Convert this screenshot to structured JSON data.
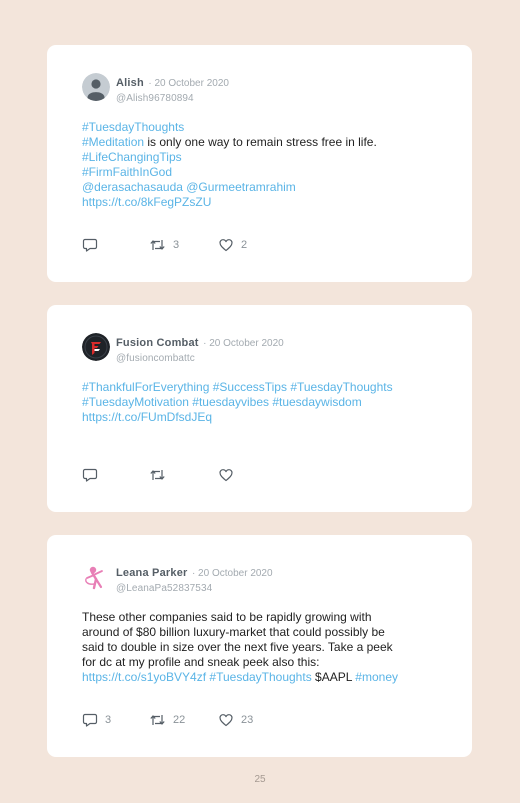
{
  "tweets": [
    {
      "name": "Alish",
      "date": "· 20 October 2020",
      "handle": "@Alish96780894",
      "lines": [
        [
          {
            "t": "#TuesdayThoughts",
            "link": true
          }
        ],
        [
          {
            "t": "#Meditation",
            "link": true
          },
          {
            "t": " is only one way to remain stress free in life.",
            "link": false
          }
        ],
        [
          {
            "t": "#LifeChangingTips",
            "link": true
          }
        ],
        [
          {
            "t": "#FirmFaithInGod",
            "link": true
          }
        ],
        [
          {
            "t": "@derasachasauda @Gurmeetramrahim",
            "link": true
          }
        ],
        [
          {
            "t": "https://t.co/8kFegPZsZU",
            "link": true
          }
        ]
      ],
      "replies": "",
      "retweets": "3",
      "likes": "2"
    },
    {
      "name": "Fusion Combat",
      "date": "· 20 October 2020",
      "handle": "@fusioncombattc",
      "lines": [
        [
          {
            "t": "#ThankfulForEverything #SuccessTips #TuesdayThoughts",
            "link": true
          }
        ],
        [
          {
            "t": "#TuesdayMotivation #tuesdayvibes #tuesdaywisdom",
            "link": true
          }
        ],
        [
          {
            "t": " ",
            "link": false
          }
        ],
        [
          {
            "t": "https://t.co/FUmDfsdJEq",
            "link": true
          }
        ]
      ],
      "replies": "",
      "retweets": "",
      "likes": ""
    },
    {
      "name": "Leana Parker",
      "date": "· 20 October 2020",
      "handle": "@LeanaPa52837534",
      "lines": [
        [
          {
            "t": "These other companies said to be rapidly growing with",
            "link": false
          }
        ],
        [
          {
            "t": "around of $80 billion luxury-market that could possibly be",
            "link": false
          }
        ],
        [
          {
            "t": "said to double in size over the next five years. Take a peek",
            "link": false
          }
        ],
        [
          {
            "t": "for dc at my profile and sneak peek also this:",
            "link": false
          }
        ],
        [
          {
            "t": "https://t.co/s1yoBVY4zf",
            "link": true
          },
          {
            "t": " ",
            "link": false
          },
          {
            "t": "#TuesdayThoughts",
            "link": true
          },
          {
            "t": " $AAPL ",
            "link": false
          },
          {
            "t": "#money",
            "link": true
          }
        ]
      ],
      "replies": "3",
      "retweets": "22",
      "likes": "23"
    }
  ],
  "page_number": "25",
  "colors": {
    "background": "#f3e5db",
    "card": "#ffffff",
    "link": "#5ab4e6",
    "muted": "#a3aab0"
  }
}
